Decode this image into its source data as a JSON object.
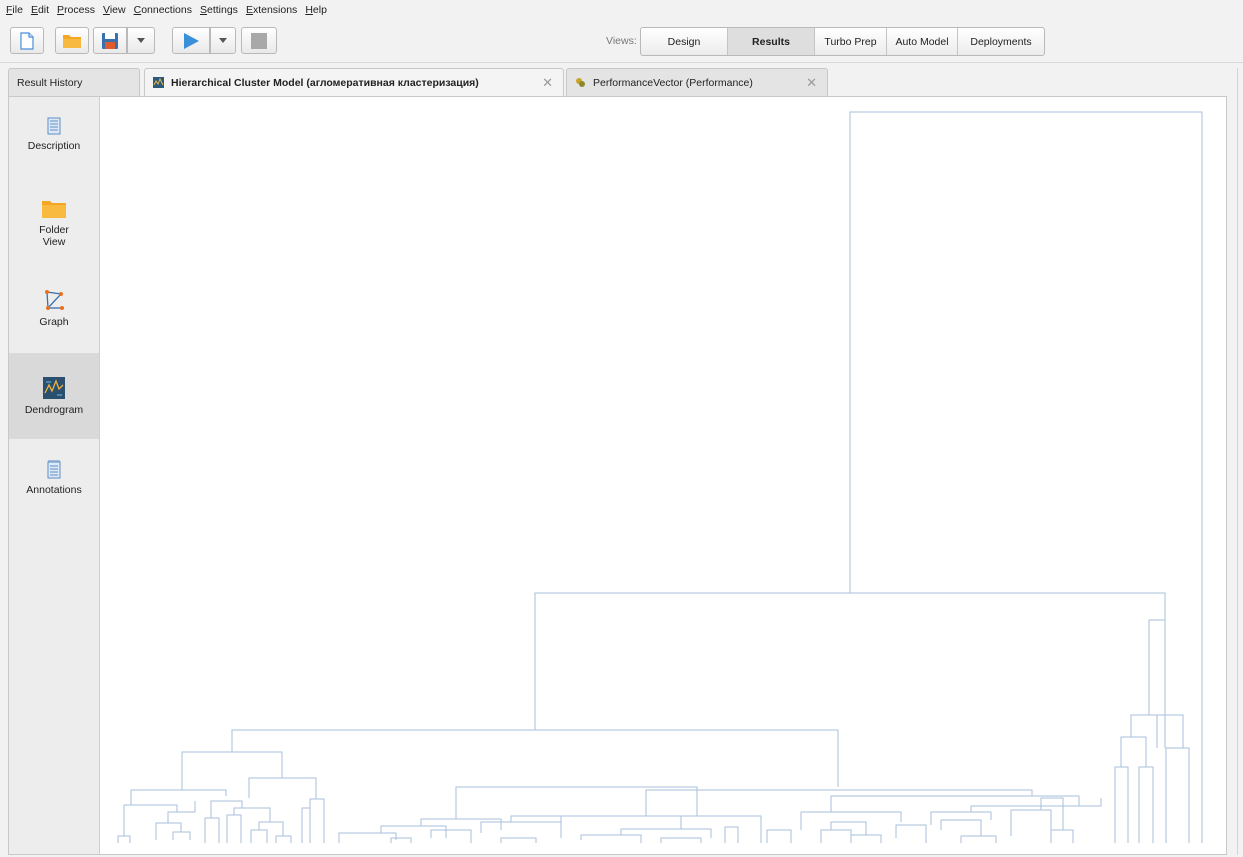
{
  "menu": {
    "items": [
      "File",
      "Edit",
      "Process",
      "View",
      "Connections",
      "Settings",
      "Extensions",
      "Help"
    ]
  },
  "toolbar": {
    "icons": [
      "new-process-icon",
      "open-folder-icon",
      "save-icon",
      "dropdown-arrow-icon",
      "run-play-icon",
      "dropdown-arrow-icon",
      "stop-icon"
    ],
    "views_label": "Views:",
    "views": [
      {
        "label": "Design",
        "active": false
      },
      {
        "label": "Results",
        "active": true
      },
      {
        "label": "Turbo Prep",
        "active": false
      },
      {
        "label": "Auto Model",
        "active": false
      },
      {
        "label": "Deployments",
        "active": false
      }
    ]
  },
  "result_tabs": [
    {
      "label": "Result History",
      "active": false,
      "closable": false
    },
    {
      "label": "Hierarchical Cluster Model (агломеративная кластеризация)",
      "active": true,
      "closable": true
    },
    {
      "label": "PerformanceVector (Performance)",
      "active": false,
      "closable": true
    }
  ],
  "sidebar": {
    "items": [
      {
        "label": "Description",
        "icon": "description-icon",
        "active": false
      },
      {
        "label": "Folder View",
        "icon": "folder-icon",
        "active": false
      },
      {
        "label": "Graph",
        "icon": "graph-icon",
        "active": false
      },
      {
        "label": "Dendrogram",
        "icon": "dendrogram-icon",
        "active": true
      },
      {
        "label": "Annotations",
        "icon": "annotations-icon",
        "active": false
      }
    ]
  },
  "colors": {
    "dendrogram_line": "#a9bfdd",
    "play_blue": "#3a8fd9",
    "folder_orange": "#f5a623",
    "selection_gray": "#d9d9d9"
  }
}
